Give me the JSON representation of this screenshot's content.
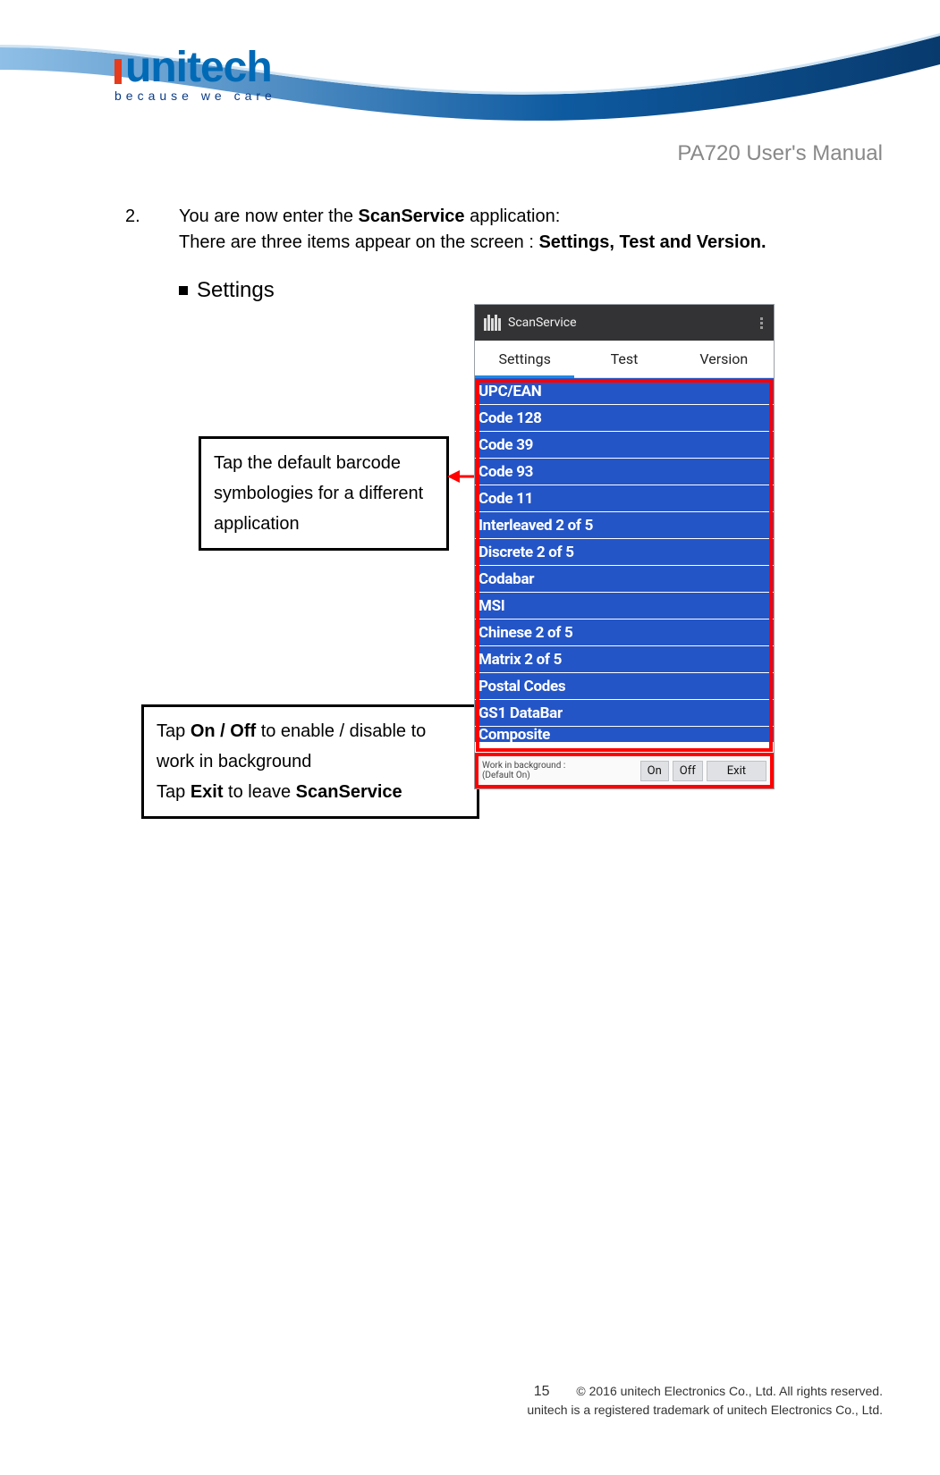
{
  "header": {
    "logo_word": "unitech",
    "logo_tagline": "because we care",
    "product_name": "PA720 User's Manual"
  },
  "body": {
    "step_number": "2.",
    "step_text_1": "You are now enter the ",
    "step_app": "ScanService",
    "step_text_2": " application:",
    "step_line2_a": "There are three items appear on the screen : ",
    "step_line2_b": "Settings, Test and Version.",
    "bullet1": "Settings"
  },
  "callout1": {
    "text": "Tap the default barcode symbologies for a different application"
  },
  "callout2": {
    "line1a": "Tap ",
    "line1b": "On / Off",
    "line1c": " to enable / disable to work in background",
    "line2a": "Tap ",
    "line2b": "Exit",
    "line2c": " to leave ",
    "line2d": "ScanService"
  },
  "phone": {
    "app_title": "ScanService",
    "tabs": {
      "settings": "Settings",
      "test": "Test",
      "version": "Version"
    },
    "list": [
      "UPC/EAN",
      "Code 128",
      "Code 39",
      "Code 93",
      "Code 11",
      "Interleaved 2 of 5",
      "Discrete 2 of 5",
      "Codabar",
      "MSI",
      "Chinese 2 of 5",
      "Matrix 2 of 5",
      "Postal Codes",
      "GS1 DataBar",
      "Composite"
    ],
    "bg_label_1": "Work in background :",
    "bg_label_2": "(Default On)",
    "btn_on": "On",
    "btn_off": "Off",
    "btn_exit": "Exit"
  },
  "footer": {
    "page": "15",
    "line1": "© 2016 unitech Electronics Co., Ltd. All rights reserved.",
    "line2": "unitech is a registered trademark of unitech Electronics Co., Ltd."
  }
}
